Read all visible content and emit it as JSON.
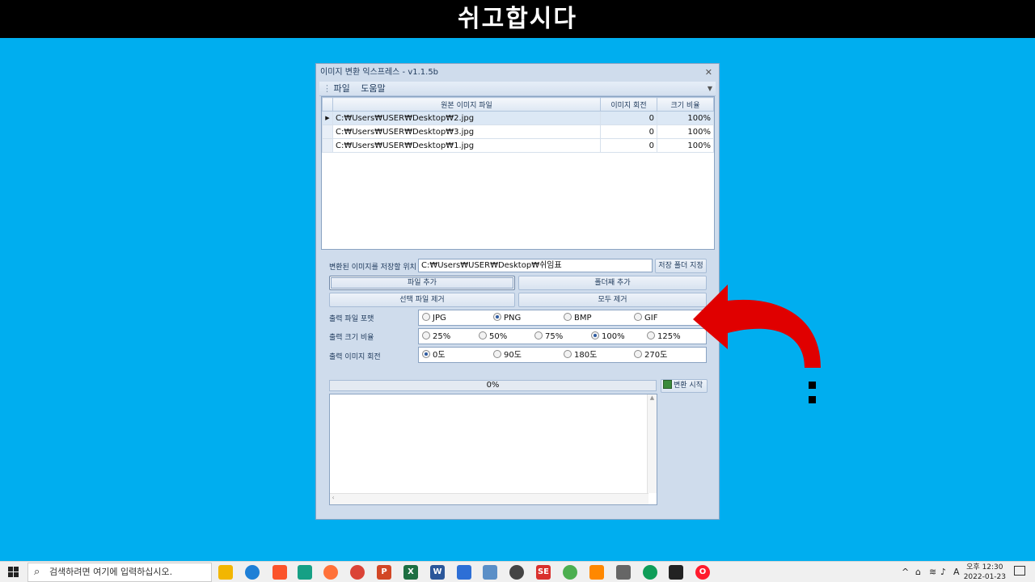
{
  "banner": {
    "title": "쉬고합시다"
  },
  "window": {
    "title": "이미지 변환 익스프레스 - v1.1.5b",
    "close_glyph": "✕",
    "menu": [
      "파일",
      "도움말"
    ],
    "grid": {
      "columns": [
        "원본 이미지 파일",
        "이미지 회전",
        "크기 비율"
      ],
      "rows": [
        {
          "file": "C:₩Users₩USER₩Desktop₩2.jpg",
          "rotation": "0",
          "scale": "100%"
        },
        {
          "file": "C:₩Users₩USER₩Desktop₩3.jpg",
          "rotation": "0",
          "scale": "100%"
        },
        {
          "file": "C:₩Users₩USER₩Desktop₩1.jpg",
          "rotation": "0",
          "scale": "100%"
        }
      ]
    },
    "save_label": "변환된 이미지를 저장할 위치",
    "save_path": "C:₩Users₩USER₩Desktop₩쉬임표",
    "save_folder_button": "저장 폴더 지정",
    "add_file_button": "파일 추가",
    "add_folder_button": "폴더째 추가",
    "remove_selected_button": "선택 파일 제거",
    "remove_all_button": "모두 제거",
    "format": {
      "label": "출력 파일 포맷",
      "options": [
        "JPG",
        "PNG",
        "BMP",
        "GIF"
      ],
      "selected": "PNG"
    },
    "scale": {
      "label": "출력 크기 비율",
      "options": [
        "25%",
        "50%",
        "75%",
        "100%",
        "125%"
      ],
      "selected": "100%"
    },
    "rotate": {
      "label": "출력 이미지 회전",
      "options": [
        "0도",
        "90도",
        "180도",
        "270도"
      ],
      "selected": "0도"
    },
    "progress": {
      "text": "0%",
      "value": 0
    },
    "start_button": "변환 시작"
  },
  "taskbar": {
    "search_placeholder": "검색하려면 여기에 입력하십시오.",
    "apps": [
      "file-explorer",
      "edge",
      "brave",
      "vscode-like",
      "firefox",
      "chrome",
      "powerpoint",
      "excel",
      "word",
      "app-blue",
      "app-monitor",
      "search-app",
      "app-red",
      "app-green",
      "vlc",
      "calculator",
      "chrome-2",
      "app-yellow",
      "opera"
    ],
    "ime": "A",
    "clock_time": "오후 12:30",
    "clock_date": "2022-01-23"
  },
  "colors": {
    "desktop": "#00aeef",
    "arrow": "#e00000",
    "banner": "#000000"
  }
}
